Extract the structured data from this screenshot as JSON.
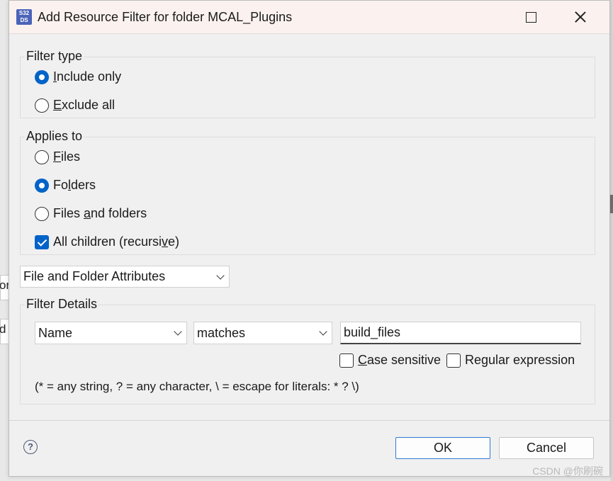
{
  "window": {
    "title": "Add Resource Filter for folder MCAL_Plugins",
    "app_icon_text": "S32 DS"
  },
  "background": {
    "fragment_1": "or",
    "fragment_2": "d"
  },
  "filter_type": {
    "label": "Filter type",
    "options": [
      {
        "pre": "",
        "mn": "I",
        "post": "nclude only",
        "checked": true
      },
      {
        "pre": "",
        "mn": "E",
        "post": "xclude all",
        "checked": false
      }
    ]
  },
  "applies_to": {
    "label": "Applies to",
    "options": [
      {
        "pre": "",
        "mn": "F",
        "post": "iles",
        "checked": false
      },
      {
        "pre": "Fo",
        "mn": "l",
        "post": "ders",
        "checked": true
      },
      {
        "pre": "Files ",
        "mn": "a",
        "post": "nd folders",
        "checked": false
      }
    ],
    "all_children": {
      "pre": "All children (recursi",
      "mn": "v",
      "post": "e)",
      "checked": true
    }
  },
  "attribute_combo": {
    "value": "File and Folder Attributes"
  },
  "filter_details": {
    "label": "Filter Details",
    "name_combo": "Name",
    "operator_combo": "matches",
    "pattern_value": "build_files",
    "case_sensitive": {
      "pre": "",
      "mn": "C",
      "post": "ase sensitive",
      "checked": false
    },
    "regex": {
      "pre": "Re",
      "mn": "g",
      "post": "ular expression",
      "checked": false
    },
    "hint": "(* = any string, ? = any character, \\ = escape for literals: * ? \\)"
  },
  "buttons": {
    "ok": "OK",
    "cancel": "Cancel",
    "help": "?"
  },
  "watermark": "CSDN @你刷碗",
  "colors": {
    "accent": "#0063c8",
    "titlebar": "#fbf2ef",
    "dialog_bg": "#f0f0f0"
  }
}
